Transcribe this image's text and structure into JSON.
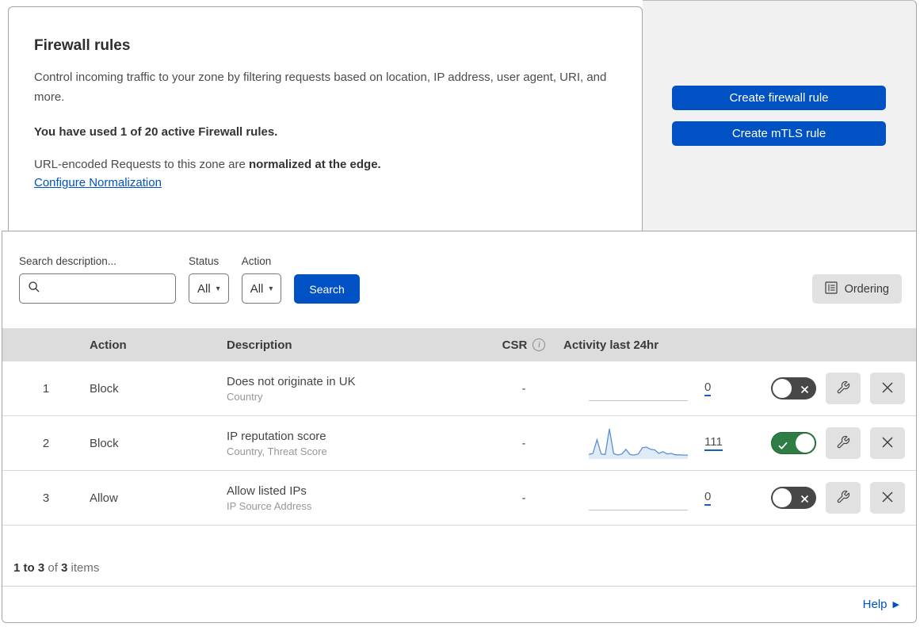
{
  "header": {
    "title": "Firewall rules",
    "description": "Control incoming traffic to your zone by filtering requests based on location, IP address, user agent, URI, and more.",
    "usage_text": "You have used 1 of 20 active Firewall rules.",
    "normalization_prefix": "URL-encoded Requests to this zone are ",
    "normalization_bold": "normalized at the edge.",
    "normalization_link": "Configure Normalization"
  },
  "actions_panel": {
    "create_firewall_rule_label": "Create firewall rule",
    "create_mtls_rule_label": "Create mTLS rule"
  },
  "filters": {
    "search_label": "Search description...",
    "search_value": "",
    "status_label": "Status",
    "status_value": "All",
    "action_label": "Action",
    "action_value": "All",
    "search_button_label": "Search",
    "ordering_button_label": "Ordering"
  },
  "table": {
    "columns": {
      "action": "Action",
      "description": "Description",
      "csr": "CSR",
      "activity": "Activity last 24hr"
    },
    "rows": [
      {
        "priority": "1",
        "action": "Block",
        "description": "Does not originate in UK",
        "criteria": "Country",
        "csr": "-",
        "activity_count": "0",
        "enabled": false,
        "sparkline": []
      },
      {
        "priority": "2",
        "action": "Block",
        "description": "IP reputation score",
        "criteria": "Country, Threat Score",
        "csr": "-",
        "activity_count": "111",
        "enabled": true,
        "sparkline": [
          10,
          14,
          62,
          12,
          10,
          100,
          14,
          8,
          12,
          28,
          10,
          8,
          12,
          34,
          36,
          28,
          26,
          14,
          20,
          12,
          14,
          9,
          9,
          8,
          8
        ]
      },
      {
        "priority": "3",
        "action": "Allow",
        "description": "Allow listed IPs",
        "criteria": "IP Source Address",
        "csr": "-",
        "activity_count": "0",
        "enabled": false,
        "sparkline": []
      }
    ]
  },
  "footer": {
    "pagination_range": "1 to 3",
    "pagination_of": " of ",
    "pagination_total": "3",
    "pagination_items": " items",
    "help_label": "Help"
  },
  "icons": {
    "caret": "▾",
    "info_glyph": "i",
    "help_arrow": "▶"
  },
  "colors": {
    "primary_blue": "#0051c3",
    "toggle_on_green": "#2e7d44",
    "toggle_off_gray": "#474747",
    "sparkline_blue": "#5b8fd6",
    "table_header_bg": "#dcdcdc",
    "panel_bg": "#f1f1f1",
    "gray_button_bg": "#e1e1e1"
  }
}
